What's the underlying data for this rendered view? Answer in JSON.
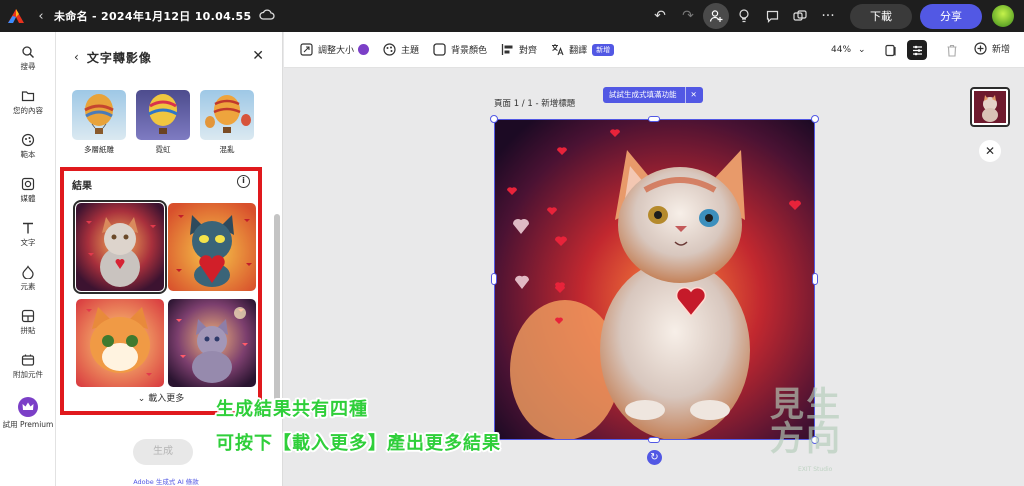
{
  "topbar": {
    "doc_title": "未命名 - 2024年1月12日 10.04.55",
    "download_label": "下載",
    "share_label": "分享"
  },
  "rail": {
    "items": [
      {
        "label": "搜尋",
        "icon": "search-icon"
      },
      {
        "label": "您的內容",
        "icon": "folder-icon"
      },
      {
        "label": "範本",
        "icon": "template-icon"
      },
      {
        "label": "媒體",
        "icon": "media-icon"
      },
      {
        "label": "文字",
        "icon": "text-icon"
      },
      {
        "label": "元素",
        "icon": "shapes-icon"
      },
      {
        "label": "拼貼",
        "icon": "grid-icon"
      },
      {
        "label": "附加元件",
        "icon": "addon-icon"
      },
      {
        "label": "試用 Premium",
        "icon": "crown-icon"
      }
    ]
  },
  "panel": {
    "title": "文字轉影像",
    "styles": [
      {
        "label": "多層紙雕"
      },
      {
        "label": "霓虹"
      },
      {
        "label": "混亂"
      }
    ],
    "results_label": "結果",
    "load_more_label": "載入更多",
    "generate_label": "生成",
    "footer_note": "Adobe 生成式 AI 條款"
  },
  "toolbar": {
    "resize_label": "調整大小",
    "theme_label": "主題",
    "bg_color_label": "背景顏色",
    "align_label": "對齊",
    "translate_label": "翻譯",
    "new_badge": "新增",
    "zoom": "44%",
    "add_label": "新增"
  },
  "canvas": {
    "page_label": "頁面 1 / 1 - 新增標題",
    "try_pill": "試試生成式填滿功能"
  },
  "captions": {
    "line1": "生成結果共有四種",
    "line2": "可按下【載入更多】產出更多結果"
  },
  "watermark": {
    "text1": "見生",
    "text2": "方向",
    "sub": "EXIT Studio"
  },
  "colors": {
    "accent": "#5258e4",
    "highlight_box": "#e0191d",
    "caption_green": "#2fcf3a",
    "topbar_bg": "#1e1e1e"
  }
}
